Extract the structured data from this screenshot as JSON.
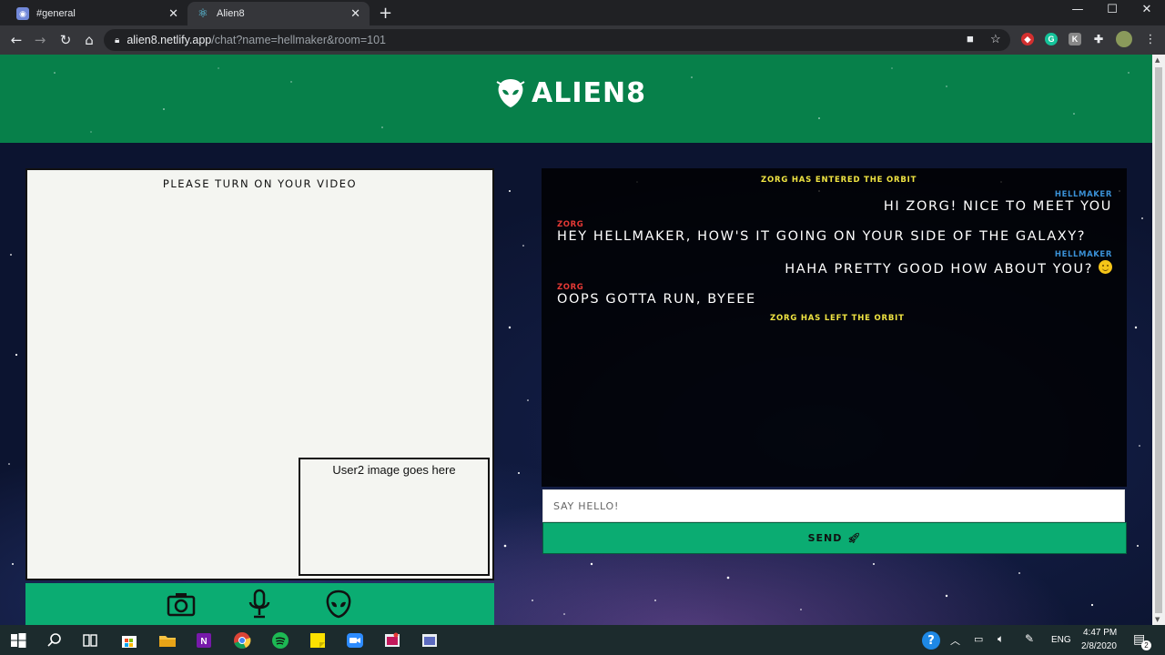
{
  "browser": {
    "tabs": [
      {
        "title": "#general",
        "close": "✕"
      },
      {
        "title": "Alien8",
        "close": "✕"
      }
    ],
    "new_tab": "+",
    "window_controls": [
      "—",
      "☐",
      "✕"
    ],
    "url_host": "alien8.netlify.app",
    "url_path": "/chat?name=hellmaker&room=101",
    "icons": [
      "back-icon",
      "forward-icon",
      "reload-icon",
      "home-icon",
      "lock-icon",
      "camera-blocked-icon",
      "bookmark-star-icon",
      "extensions-icon",
      "profile-avatar-icon",
      "menu-icon"
    ]
  },
  "header": {
    "app_name": "ALIEN8"
  },
  "video": {
    "title": "PLEASE TURN ON YOUR VIDEO",
    "user2_placeholder": "User2 image goes here"
  },
  "controls": {
    "icons": [
      "camera-icon",
      "microphone-icon",
      "alien-icon"
    ]
  },
  "chat": {
    "sys_entered": "ZORG HAS ENTERED THE ORBIT",
    "m1_sender": "HELLMAKER",
    "m1_text": "HI ZORG! NICE TO MEET YOU",
    "m2_sender": "ZORG",
    "m2_text": "HEY HELLMAKER, HOW'S IT GOING ON YOUR SIDE OF THE GALAXY?",
    "m3_sender": "HELLMAKER",
    "m3_text": "HAHA PRETTY GOOD HOW ABOUT YOU?",
    "m4_sender": "ZORG",
    "m4_text": "OOPS GOTTA RUN, BYEEE",
    "sys_left": "ZORG HAS LEFT THE ORBIT"
  },
  "composer": {
    "placeholder": "SAY HELLO!",
    "send_label": "SEND"
  },
  "colors": {
    "header_green": "#07804a",
    "accent_green": "#0bac72",
    "system_yellow": "#f0e442",
    "self_blue": "#3a91d6",
    "other_red": "#e53935"
  },
  "taskbar": {
    "time": "4:47 PM",
    "date": "2/8/2020",
    "lang": "ENG",
    "notif_count": "2"
  }
}
